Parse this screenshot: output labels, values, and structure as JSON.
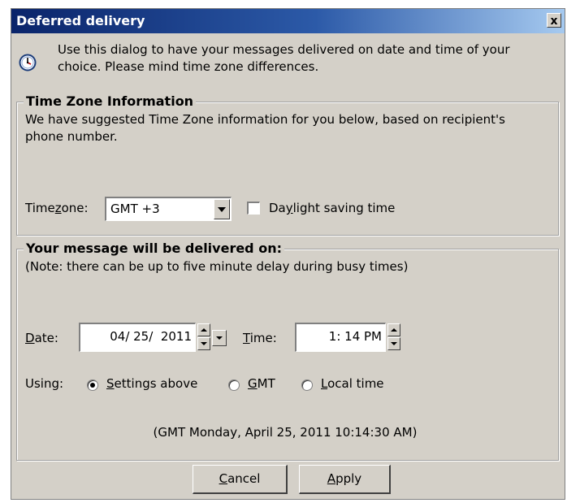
{
  "window": {
    "title": "Deferred delivery",
    "close_label": "x"
  },
  "intro": {
    "icon": "clock-icon",
    "text": "Use this dialog to have your messages delivered on date and time of your choice. Please mind time zone differences."
  },
  "timezone_group": {
    "legend": "Time Zone Information",
    "description": "We have suggested Time Zone information for you below, based on recipient's phone number.",
    "timezone_label_pre": "Time",
    "timezone_label_accel": "z",
    "timezone_label_post": "one:",
    "timezone_value": "GMT +3",
    "dst_checked": false,
    "dst_label_pre": "Da",
    "dst_label_accel": "y",
    "dst_label_post": "light saving time"
  },
  "delivery_group": {
    "legend": "Your message will be delivered on:",
    "note": "(Note: there can be up to five minute delay during busy times)",
    "date_label_accel": "D",
    "date_label_post": "ate:",
    "date_value": "04/ 25/  2011",
    "time_label_accel": "T",
    "time_label_post": "ime:",
    "time_value": "1: 14 PM",
    "using_label": "Using:",
    "options": [
      {
        "accel": "S",
        "label": "ettings above",
        "selected": true
      },
      {
        "accel": "G",
        "label": "MT",
        "selected": false
      },
      {
        "accel": "L",
        "label": "ocal time",
        "selected": false
      }
    ],
    "gmt_text": "(GMT Monday, April 25, 2011 10:14:30 AM)"
  },
  "buttons": {
    "cancel_accel": "C",
    "cancel_post": "ancel",
    "apply_accel": "A",
    "apply_post": "pply"
  }
}
